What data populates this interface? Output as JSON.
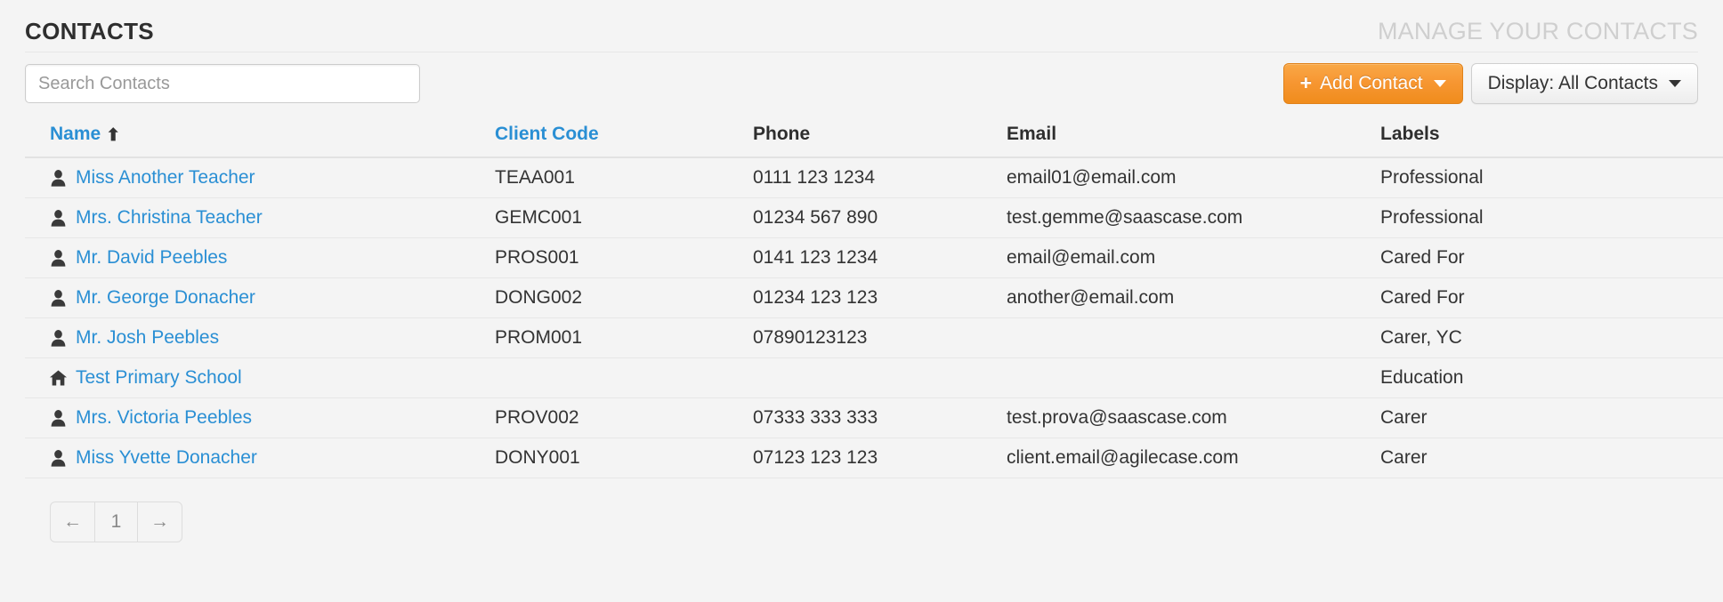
{
  "header": {
    "title": "CONTACTS",
    "subtitle": "MANAGE YOUR CONTACTS"
  },
  "toolbar": {
    "search_placeholder": "Search Contacts",
    "search_value": "",
    "add_contact_label": "Add Contact",
    "add_contact_plus": "+",
    "display_label": "Display: All Contacts"
  },
  "table": {
    "columns": [
      {
        "key": "name",
        "label": "Name",
        "link": true,
        "sorted": true,
        "sort_arrow": "⬆"
      },
      {
        "key": "code",
        "label": "Client Code",
        "link": true,
        "sorted": false
      },
      {
        "key": "phone",
        "label": "Phone",
        "link": false,
        "sorted": false
      },
      {
        "key": "email",
        "label": "Email",
        "link": false,
        "sorted": false
      },
      {
        "key": "labels",
        "label": "Labels",
        "link": false,
        "sorted": false
      }
    ],
    "rows": [
      {
        "icon": "person-icon",
        "name": "Miss Another Teacher",
        "code": "TEAA001",
        "phone": "0111 123 1234",
        "email": "email01@email.com",
        "labels": "Professional"
      },
      {
        "icon": "person-icon",
        "name": "Mrs. Christina Teacher",
        "code": "GEMC001",
        "phone": "01234 567 890",
        "email": "test.gemme@saascase.com",
        "labels": "Professional"
      },
      {
        "icon": "person-icon",
        "name": "Mr. David Peebles",
        "code": "PROS001",
        "phone": "0141 123 1234",
        "email": "email@email.com",
        "labels": "Cared For"
      },
      {
        "icon": "person-icon",
        "name": "Mr. George Donacher",
        "code": "DONG002",
        "phone": "01234 123 123",
        "email": "another@email.com",
        "labels": "Cared For"
      },
      {
        "icon": "person-icon",
        "name": "Mr. Josh Peebles",
        "code": "PROM001",
        "phone": "07890123123",
        "email": "",
        "labels": "Carer, YC"
      },
      {
        "icon": "home-icon",
        "name": "Test Primary School",
        "code": "",
        "phone": "",
        "email": "",
        "labels": "Education"
      },
      {
        "icon": "person-icon",
        "name": "Mrs. Victoria Peebles",
        "code": "PROV002",
        "phone": "07333 333 333",
        "email": "test.prova@saascase.com",
        "labels": "Carer"
      },
      {
        "icon": "person-icon",
        "name": "Miss Yvette Donacher",
        "code": "DONY001",
        "phone": "07123 123 123",
        "email": "client.email@agilecase.com",
        "labels": "Carer"
      }
    ]
  },
  "pagination": {
    "prev_label": "←",
    "next_label": "→",
    "current_page": "1"
  },
  "colors": {
    "link": "#2a8fd4",
    "accent_orange": "#f7963a",
    "page_bg": "#f4f4f4",
    "subtitle_gray": "#cfcfcf"
  }
}
